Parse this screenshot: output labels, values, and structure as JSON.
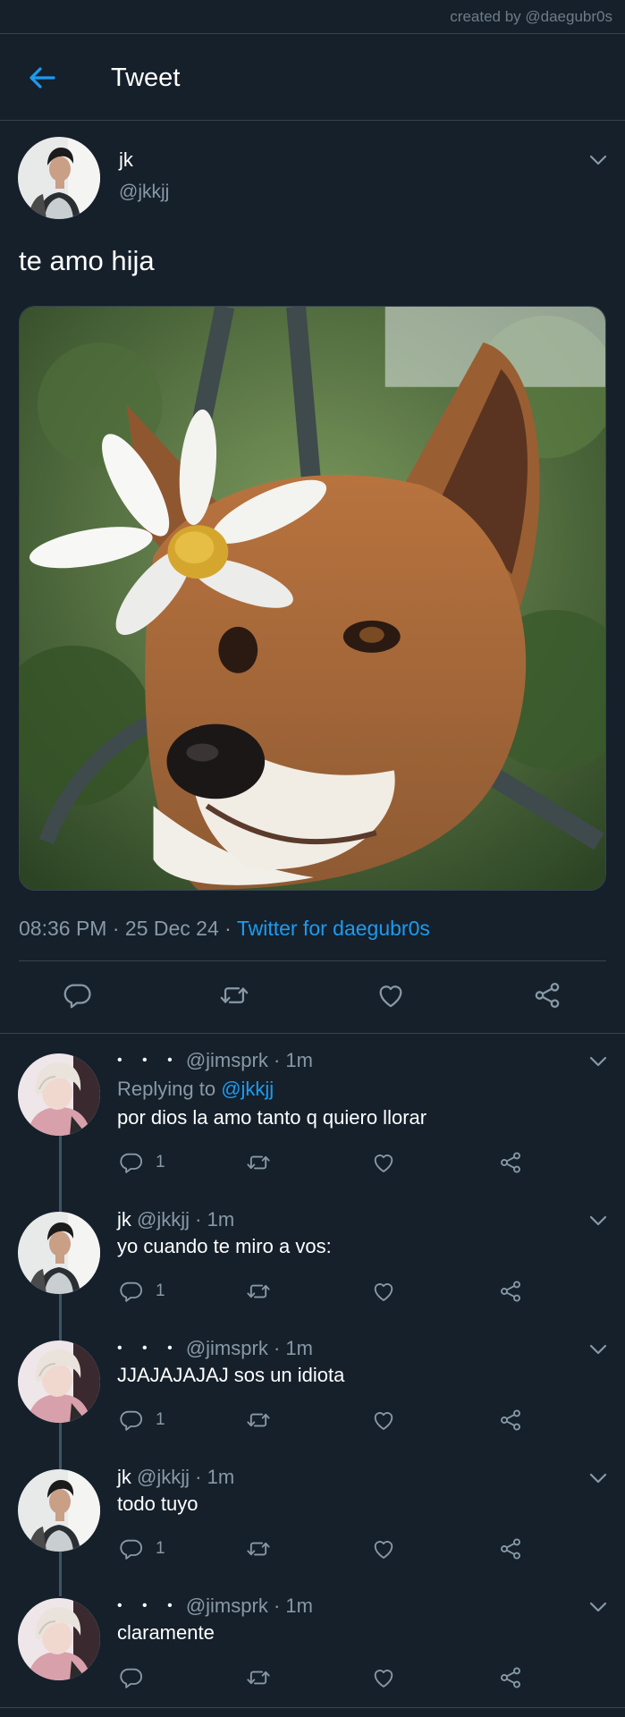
{
  "watermark": "created by @daegubr0s",
  "header": {
    "title": "Tweet"
  },
  "tweet": {
    "name": "jk",
    "handle": "@jkkjj",
    "text": "te amo hija",
    "time": "08:36 PM",
    "date": "25 Dec 24",
    "app": "Twitter for daegubr0s",
    "separator": "·"
  },
  "replies": [
    {
      "name": "• • •",
      "handle": "@jimsprk",
      "age": "1m",
      "replying_label": "Replying to",
      "replying_to": "@jkkjj",
      "text": "por dios la amo tanto q quiero llorar",
      "reply_count": "1",
      "avatar": "blond"
    },
    {
      "name": "jk",
      "handle": "@jkkjj",
      "age": "1m",
      "text": "yo cuando te miro a vos:",
      "reply_count": "1",
      "avatar": "dark"
    },
    {
      "name": "• • •",
      "handle": "@jimsprk",
      "age": "1m",
      "text": "JJAJAJAJAJ sos un idiota",
      "reply_count": "1",
      "avatar": "blond"
    },
    {
      "name": "jk",
      "handle": "@jkkjj",
      "age": "1m",
      "text": "todo tuyo",
      "reply_count": "1",
      "avatar": "dark"
    },
    {
      "name": "• • •",
      "handle": "@jimsprk",
      "age": "1m",
      "text": "claramente",
      "reply_count": "",
      "avatar": "blond"
    }
  ],
  "icons": {
    "back": "back-arrow-icon",
    "chevron": "chevron-down-icon",
    "reply": "reply-icon",
    "retweet": "retweet-icon",
    "like": "heart-icon",
    "share": "share-icon"
  },
  "colors": {
    "background": "#15202b",
    "accent": "#1d9bf0",
    "muted": "#8899a6",
    "divider": "#38444d"
  }
}
